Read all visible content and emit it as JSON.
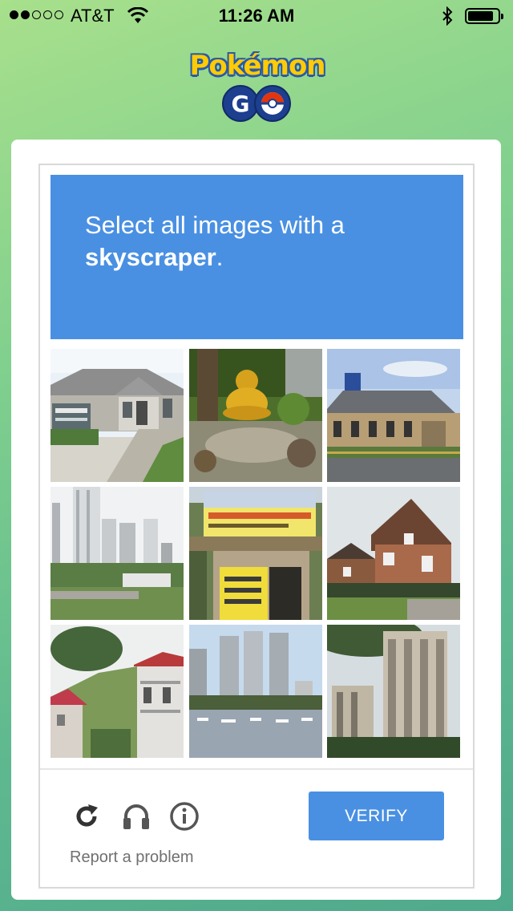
{
  "status_bar": {
    "carrier": "AT&T",
    "time": "11:26 AM",
    "battery_level": 0.85
  },
  "logo": {
    "title": "Pokémon",
    "subtitle": "GO"
  },
  "captcha": {
    "instruction_line1": "Select all images with a",
    "instruction_target": "skyscraper",
    "instruction_end": ".",
    "tiles": [
      {
        "label": "house-with-sign"
      },
      {
        "label": "golden-buddha-statue"
      },
      {
        "label": "single-story-building"
      },
      {
        "label": "city-high-rises"
      },
      {
        "label": "storefront-sign"
      },
      {
        "label": "brick-house"
      },
      {
        "label": "hillside-houses"
      },
      {
        "label": "waterfront-towers"
      },
      {
        "label": "tall-apartment-tower"
      }
    ],
    "verify_label": "VERIFY",
    "report_label": "Report a problem",
    "icons": [
      "reload-icon",
      "headphones-icon",
      "info-icon"
    ]
  },
  "colors": {
    "accent": "#4a90e2",
    "background_start": "#a8e08c",
    "background_end": "#4fa98c"
  }
}
